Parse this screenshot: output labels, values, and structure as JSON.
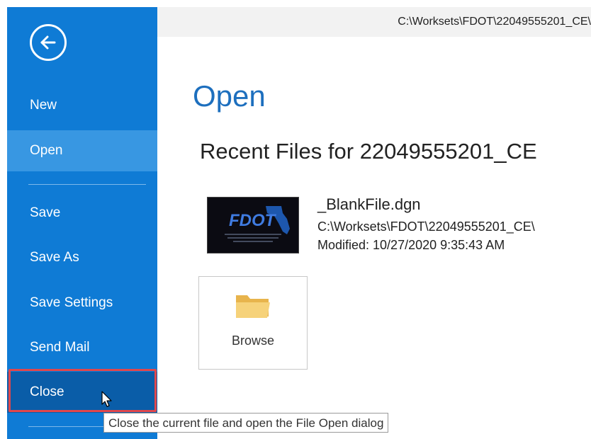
{
  "header": {
    "path": "C:\\Worksets\\FDOT\\22049555201_CE\\"
  },
  "sidebar": {
    "back_icon": "back-arrow-icon",
    "items": [
      {
        "label": "New"
      },
      {
        "label": "Open"
      },
      {
        "label": "Save"
      },
      {
        "label": "Save As"
      },
      {
        "label": "Save Settings"
      },
      {
        "label": "Send Mail"
      },
      {
        "label": "Close"
      }
    ],
    "selected": "Open",
    "hovered": "Close"
  },
  "main": {
    "title": "Open",
    "recent_heading": "Recent Files for 22049555201_CE",
    "recent_files": [
      {
        "name": "_BlankFile.dgn",
        "path": "C:\\Worksets\\FDOT\\22049555201_CE\\",
        "modified": "Modified: 10/27/2020 9:35:43 AM",
        "thumbnail_logo": "FDOT"
      }
    ],
    "browse_label": "Browse"
  },
  "tooltip": {
    "text": "Close the current file and open the File Open dialog"
  },
  "colors": {
    "sidebar": "#0f7bd5",
    "sidebar_selected": "#3897e2",
    "sidebar_hover": "#0a5da8",
    "title": "#1d6fbe",
    "highlight": "#e0474c"
  }
}
